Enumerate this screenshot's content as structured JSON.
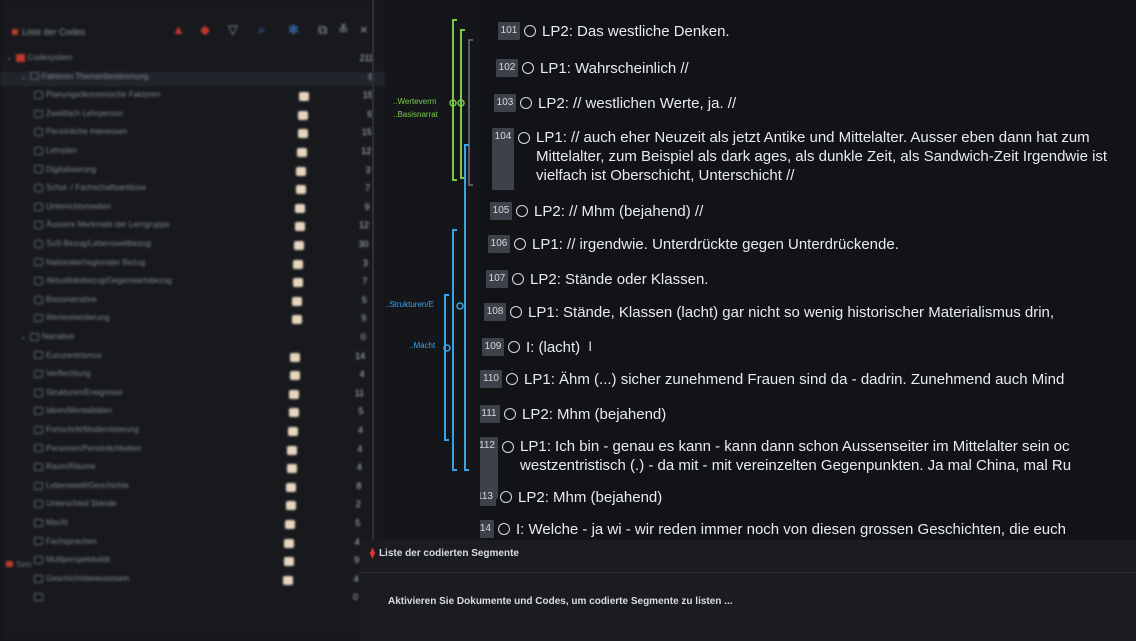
{
  "left_panel": {
    "title": "Liste der Codes",
    "toolbar_icons": [
      "new-code-icon",
      "new-code-alt-icon",
      "filter-icon",
      "search-icon",
      "settings-icon",
      "undock-icon",
      "collapse-icon",
      "close-icon"
    ],
    "close_glyph": "×",
    "codes": [
      {
        "label": "Codesystem",
        "count": "211",
        "level": 0,
        "chev": "⌄",
        "swatch": false,
        "red": true
      },
      {
        "label": "Faktoren Themenbestimmung",
        "count": "0",
        "level": 1,
        "chev": "⌄",
        "swatch": false,
        "selected": true
      },
      {
        "label": "Planungsökonomische Faktoren",
        "count": "15",
        "level": 2,
        "swatch": true
      },
      {
        "label": "Zweitfach Lehrperson",
        "count": "6",
        "level": 2,
        "swatch": true
      },
      {
        "label": "Persönliche Interessen",
        "count": "15",
        "level": 2,
        "swatch": true
      },
      {
        "label": "Lehrplan",
        "count": "12",
        "level": 2,
        "swatch": true
      },
      {
        "label": "Digitalisierung",
        "count": "3",
        "level": 2,
        "swatch": true
      },
      {
        "label": "Schul- / Fachschaftsanlässe",
        "count": "7",
        "level": 2,
        "swatch": true
      },
      {
        "label": "Unterrichtsmedien",
        "count": "9",
        "level": 2,
        "swatch": true
      },
      {
        "label": "Äussere Merkmale der Lerngruppe",
        "count": "12",
        "level": 2,
        "swatch": true
      },
      {
        "label": "SuS-Bezug/Lebensweltbezug",
        "count": "30",
        "level": 2,
        "swatch": true
      },
      {
        "label": "Nationaler/regionaler Bezug",
        "count": "3",
        "level": 2,
        "swatch": true
      },
      {
        "label": "Aktualitätsbezug/Gegenwartsbezug",
        "count": "7",
        "level": 2,
        "swatch": true
      },
      {
        "label": "Basisnarrative",
        "count": "5",
        "level": 2,
        "swatch": true
      },
      {
        "label": "Werteorientierung",
        "count": "9",
        "level": 2,
        "swatch": true
      },
      {
        "label": "Narrative",
        "count": "0",
        "level": 1,
        "chev": "⌄",
        "swatch": false
      },
      {
        "label": "Eurozentrismus",
        "count": "14",
        "level": 2,
        "swatch": true
      },
      {
        "label": "Verflechtung",
        "count": "4",
        "level": 2,
        "swatch": true
      },
      {
        "label": "Strukturen/Ereignisse",
        "count": "11",
        "level": 2,
        "swatch": true
      },
      {
        "label": "Ideen/Mentalitäten",
        "count": "5",
        "level": 2,
        "swatch": true
      },
      {
        "label": "Fortschritt/Modernisierung",
        "count": "4",
        "level": 2,
        "swatch": true
      },
      {
        "label": "Personen/Persönlichkeiten",
        "count": "4",
        "level": 2,
        "swatch": true
      },
      {
        "label": "Raum/Räume",
        "count": "4",
        "level": 2,
        "swatch": true
      },
      {
        "label": "Lebenswelt/Geschichte",
        "count": "8",
        "level": 2,
        "swatch": true
      },
      {
        "label": "Unterschied Stände",
        "count": "2",
        "level": 2,
        "swatch": true
      },
      {
        "label": "Macht",
        "count": "5",
        "level": 2,
        "swatch": true
      },
      {
        "label": "Fachsprachen",
        "count": "4",
        "level": 2,
        "swatch": true
      },
      {
        "label": "Multiperspektivität",
        "count": "9",
        "level": 2,
        "swatch": true
      },
      {
        "label": "Geschichtsbewusstsein",
        "count": "4",
        "level": 2,
        "swatch": true
      },
      {
        "label": "",
        "count": "0",
        "level": 2,
        "swatch": false
      }
    ],
    "sets_label": "Sets"
  },
  "gutter": {
    "stripe_labels": [
      {
        "text": "..Werteverm",
        "color": "green"
      },
      {
        "text": "..Basisnarrat",
        "color": "green"
      },
      {
        "text": "..Strukturen/E",
        "color": "blue"
      },
      {
        "text": "..Macht",
        "color": "blue"
      }
    ]
  },
  "document": {
    "paragraphs": [
      {
        "num": "101",
        "text": "LP2: Das westliche Denken."
      },
      {
        "num": "102",
        "text": "LP1: Wahrscheinlich //"
      },
      {
        "num": "103",
        "text": "LP2: // westlichen Werte, ja. //"
      },
      {
        "num": "104",
        "text": "LP1: // auch eher Neuzeit als jetzt Antike und Mittelalter. Ausser eben dann hat zum Mittelalter, zum Beispiel als dark ages, als dunkle Zeit, als Sandwich-Zeit Irgendwie ist vielfach ist Oberschicht, Unterschicht //",
        "multi": true
      },
      {
        "num": "105",
        "text": "LP2: // Mhm (bejahend) //"
      },
      {
        "num": "106",
        "text": "LP1: // irgendwie. Unterdrückte gegen Unterdrückende."
      },
      {
        "num": "107",
        "text": "LP2: Stände oder Klassen."
      },
      {
        "num": "108",
        "text": "LP1: Stände, Klassen (lacht) gar nicht so wenig historischer Materialismus drin,"
      },
      {
        "num": "109",
        "text": "I: (lacht)",
        "cursor": "I"
      },
      {
        "num": "110",
        "text": "LP1: Ähm (...) sicher zunehmend Frauen sind da - dadrin. Zunehmend auch Mind"
      },
      {
        "num": "111",
        "text": "LP2: Mhm (bejahend)"
      },
      {
        "num": "112",
        "text": "LP1: Ich bin - genau es kann - kann dann schon Aussenseiter im Mittelalter sein oc westzentristisch (.) - da mit - mit vereinzelten Gegenpunkten. Ja mal China, mal Ru",
        "multi": true
      },
      {
        "num": "113",
        "text": "LP2: Mhm (bejahend)"
      },
      {
        "num": "114",
        "text": "I: Welche - ja wi - wir reden immer noch von diesen grossen Geschichten, die euch"
      }
    ]
  },
  "segments_panel": {
    "title": "Liste der codierten Segmente",
    "hint": "Aktivieren Sie Dokumente und Codes, um codierte Segmente zu listen ..."
  }
}
